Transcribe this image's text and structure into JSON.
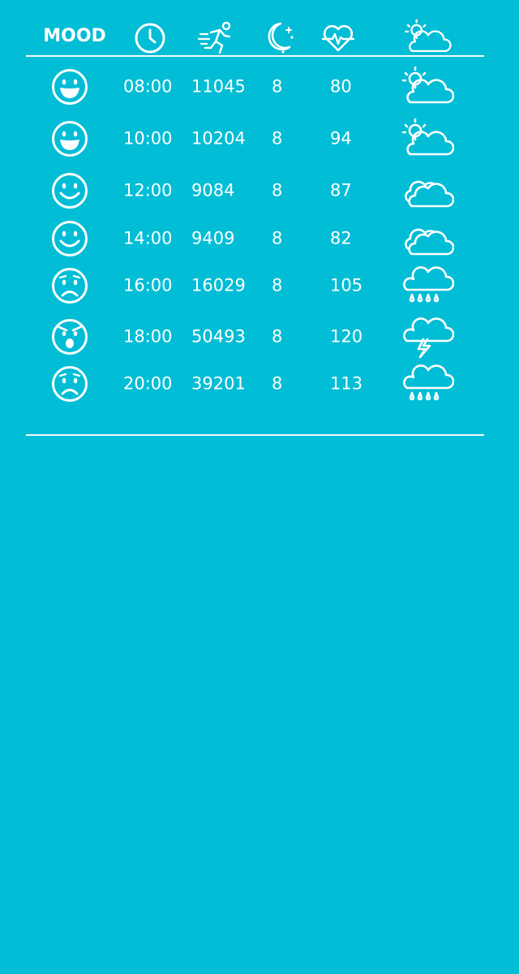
{
  "header": {
    "mood_label": "MOOD",
    "columns": [
      {
        "icon": "clock-icon"
      },
      {
        "icon": "running-icon"
      },
      {
        "icon": "moon-icon"
      },
      {
        "icon": "heart-rate-icon"
      },
      {
        "icon": "weather-icon"
      }
    ]
  },
  "colors": {
    "background": "#01bdd6",
    "foreground": "#ffffff"
  },
  "rows": [
    {
      "mood": "big-smile",
      "time": "08:00",
      "steps": "11045",
      "sleep": "8",
      "heart": "80",
      "weather": "partly-sunny"
    },
    {
      "mood": "big-smile",
      "time": "10:00",
      "steps": "10204",
      "sleep": "8",
      "heart": "94",
      "weather": "partly-sunny"
    },
    {
      "mood": "smile",
      "time": "12:00",
      "steps": "9084",
      "sleep": "8",
      "heart": "87",
      "weather": "cloudy"
    },
    {
      "mood": "smile",
      "time": "14:00",
      "steps": "9409",
      "sleep": "8",
      "heart": "82",
      "weather": "cloudy"
    },
    {
      "mood": "sad",
      "time": "16:00",
      "steps": "16029",
      "sleep": "8",
      "heart": "105",
      "weather": "rain"
    },
    {
      "mood": "angry",
      "time": "18:00",
      "steps": "50493",
      "sleep": "8",
      "heart": "120",
      "weather": "thunderstorm"
    },
    {
      "mood": "sad",
      "time": "20:00",
      "steps": "39201",
      "sleep": "8",
      "heart": "113",
      "weather": "rain"
    }
  ]
}
